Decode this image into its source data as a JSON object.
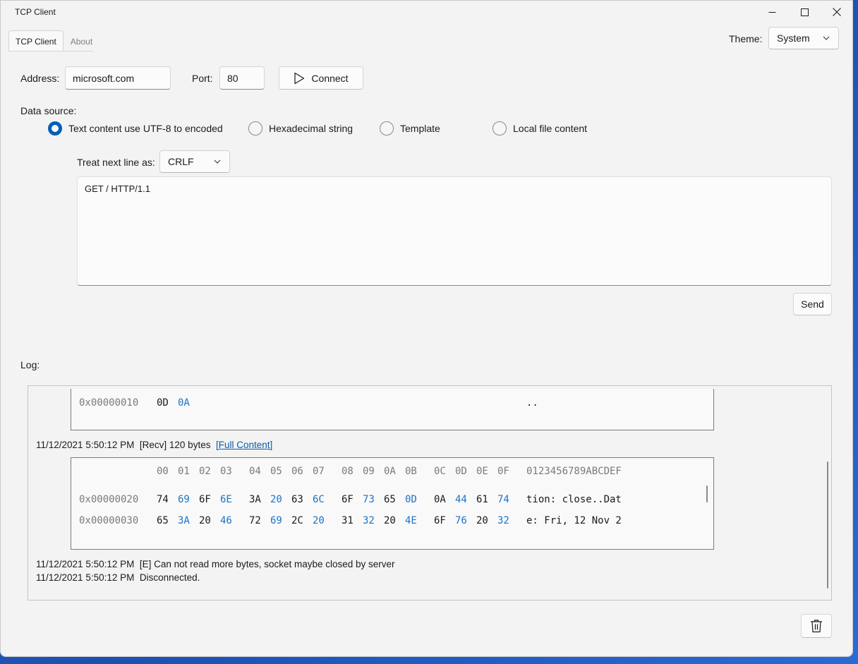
{
  "window": {
    "title": "TCP Client"
  },
  "tabs": [
    {
      "label": "TCP Client"
    },
    {
      "label": "About"
    }
  ],
  "theme": {
    "label": "Theme:",
    "value": "System"
  },
  "connection": {
    "address_label": "Address:",
    "address_value": "microsoft.com",
    "port_label": "Port:",
    "port_value": "80",
    "connect_label": "Connect"
  },
  "data_source": {
    "label": "Data source:",
    "options": [
      {
        "label": "Text content use UTF-8 to encoded",
        "selected": true
      },
      {
        "label": "Hexadecimal string",
        "selected": false
      },
      {
        "label": "Template",
        "selected": false
      },
      {
        "label": "Local file content",
        "selected": false
      }
    ]
  },
  "newline": {
    "label": "Treat next line as:",
    "value": "CRLF"
  },
  "payload": {
    "text": "GET / HTTP/1.1"
  },
  "send_label": "Send",
  "log": {
    "label": "Log:",
    "block1": {
      "offset": "0x00000010",
      "bytes": [
        "0D",
        "0A"
      ],
      "ascii": ".."
    },
    "recv_entry": {
      "time": "11/12/2021 5:50:12 PM",
      "tag": "[Recv]",
      "size": "120 bytes",
      "link": "[Full Content]"
    },
    "block2": {
      "header": [
        "00",
        "01",
        "02",
        "03",
        "04",
        "05",
        "06",
        "07",
        "08",
        "09",
        "0A",
        "0B",
        "0C",
        "0D",
        "0E",
        "0F"
      ],
      "header_ascii": "0123456789ABCDEF",
      "rows": [
        {
          "offset": "0x00000020",
          "bytes": [
            "74",
            "69",
            "6F",
            "6E",
            "3A",
            "20",
            "63",
            "6C",
            "6F",
            "73",
            "65",
            "0D",
            "0A",
            "44",
            "61",
            "74"
          ],
          "ascii": "tion: close..Dat"
        },
        {
          "offset": "0x00000030",
          "bytes": [
            "65",
            "3A",
            "20",
            "46",
            "72",
            "69",
            "2C",
            "20",
            "31",
            "32",
            "20",
            "4E",
            "6F",
            "76",
            "20",
            "32"
          ],
          "ascii": "e: Fri, 12 Nov 2"
        }
      ]
    },
    "entries": [
      {
        "time": "11/12/2021 5:50:12 PM",
        "text": "[E] Can not read more bytes, socket maybe closed by server"
      },
      {
        "time": "11/12/2021 5:50:12 PM",
        "text": "Disconnected."
      }
    ]
  },
  "colors": {
    "accent": "#005fb8",
    "hex_odd": "#1a73c7",
    "link": "#0b5cad"
  },
  "icons": {
    "minimize": "minimize-icon",
    "maximize": "maximize-icon",
    "close": "close-icon",
    "connect": "play-icon",
    "clear": "trash-icon"
  }
}
